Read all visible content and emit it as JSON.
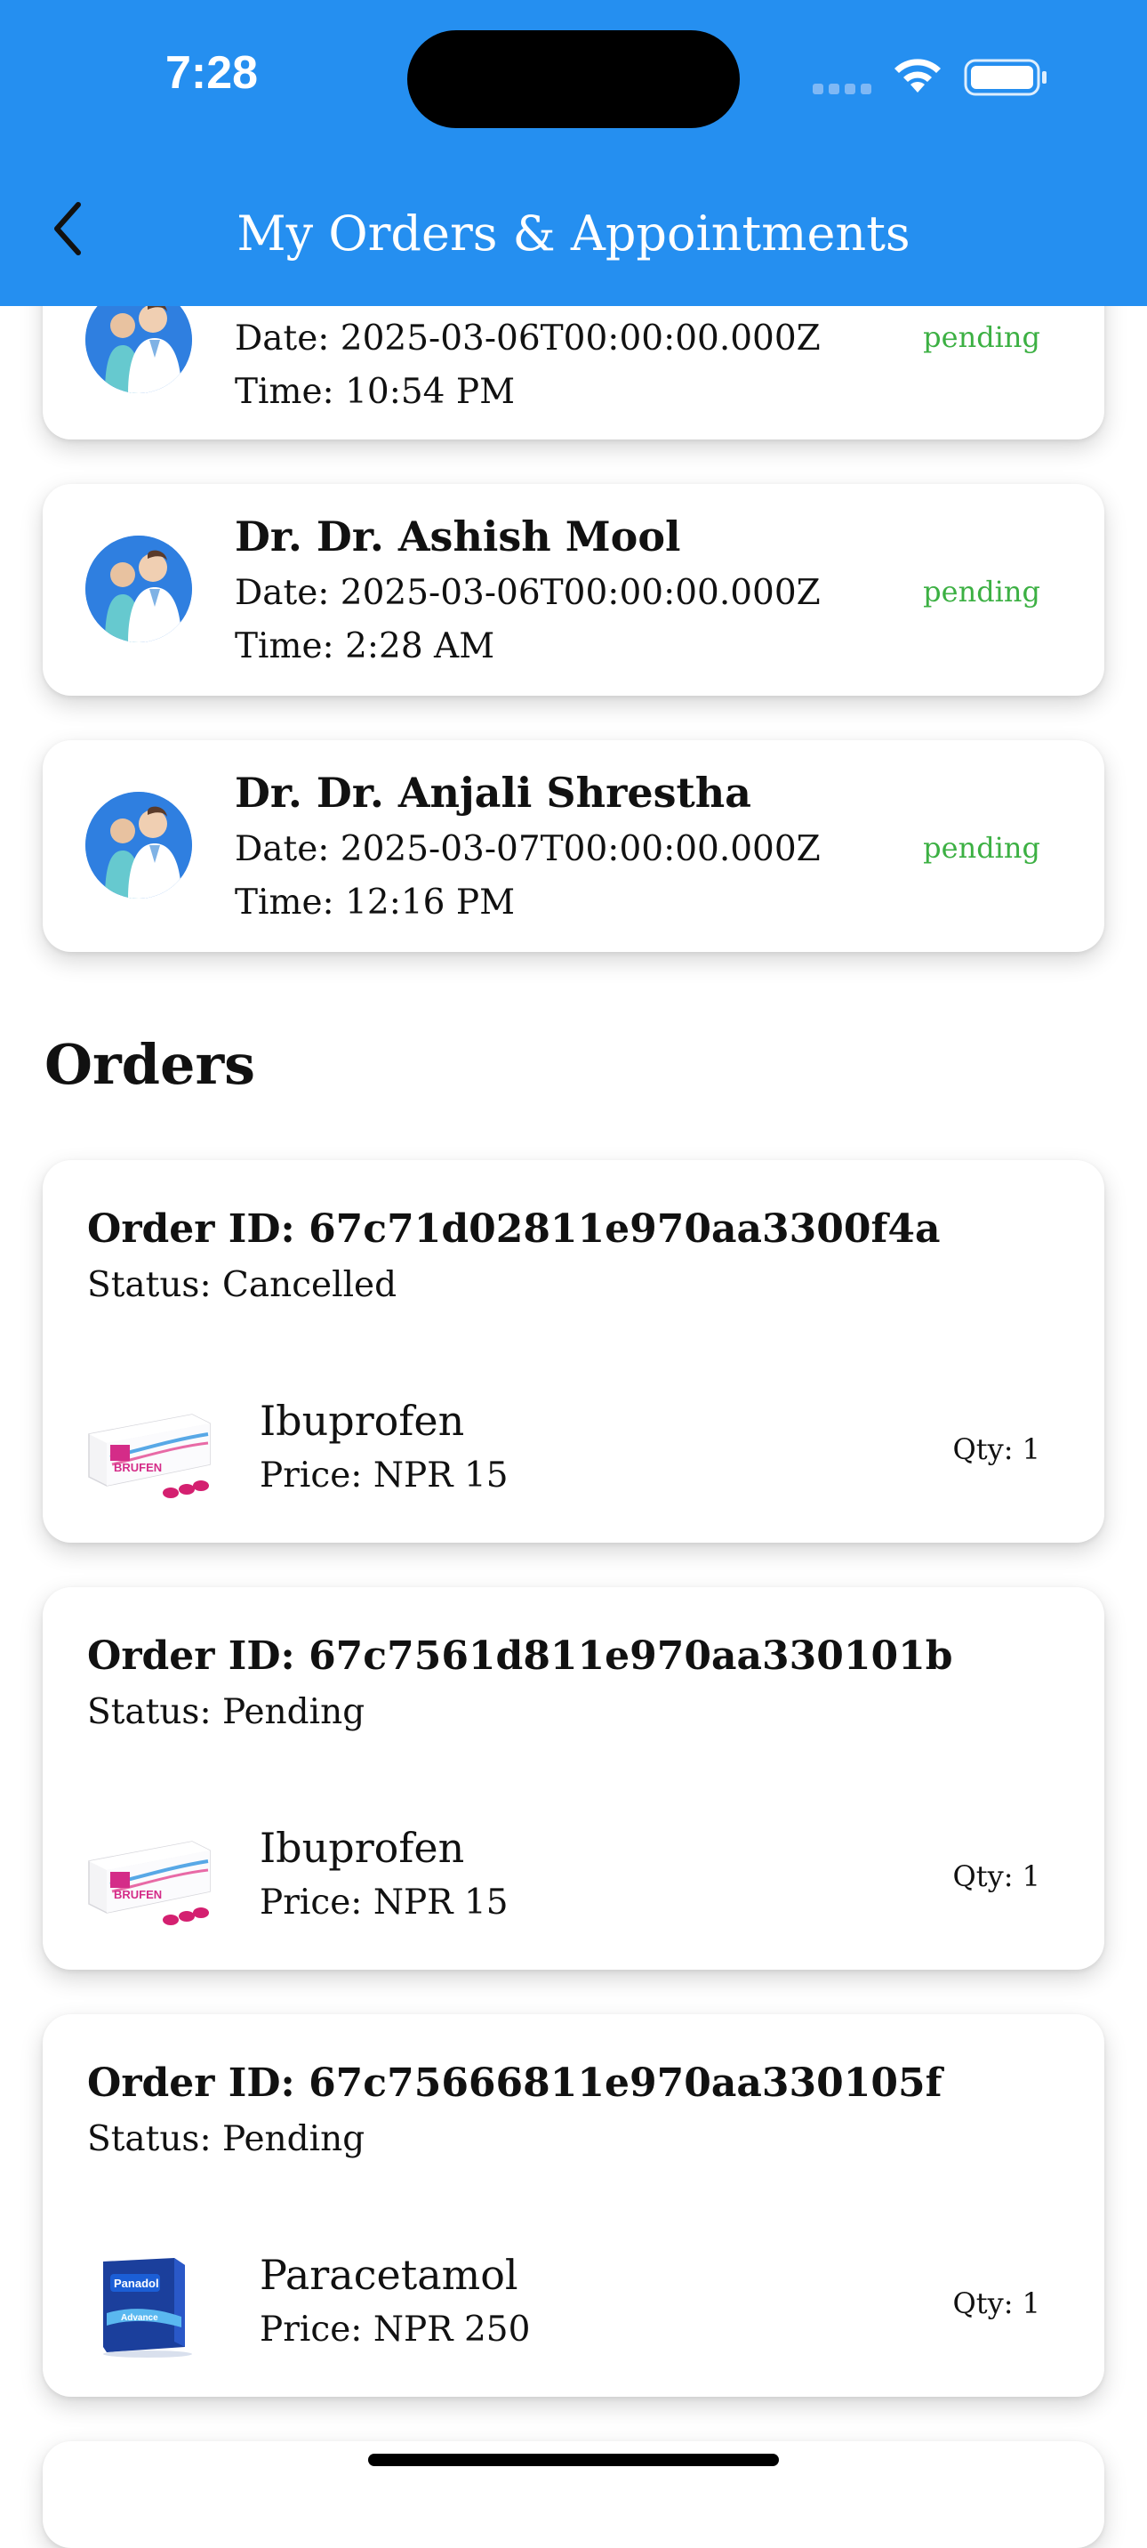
{
  "status_bar": {
    "time": "7:28"
  },
  "header": {
    "title": "My Orders & Appointments"
  },
  "appointments": [
    {
      "doctor": "",
      "date": "Date: 2025-03-06T00:00:00.000Z",
      "time": "Time: 10:54 PM",
      "status": "pending"
    },
    {
      "doctor": "Dr. Dr. Ashish Mool",
      "date": "Date: 2025-03-06T00:00:00.000Z",
      "time": "Time: 2:28 AM",
      "status": "pending"
    },
    {
      "doctor": "Dr. Dr. Anjali Shrestha",
      "date": "Date: 2025-03-07T00:00:00.000Z",
      "time": "Time: 12:16 PM",
      "status": "pending"
    }
  ],
  "orders_section": {
    "title": "Orders"
  },
  "orders": [
    {
      "order_id": "Order ID: 67c71d02811e970aa3300f4a",
      "status": "Status: Cancelled",
      "item": {
        "name": "Ibuprofen",
        "price": "Price: NPR 15",
        "qty": "Qty: 1",
        "image": "brufen-box"
      }
    },
    {
      "order_id": "Order ID: 67c7561d811e970aa330101b",
      "status": "Status: Pending",
      "item": {
        "name": "Ibuprofen",
        "price": "Price: NPR 15",
        "qty": "Qty: 1",
        "image": "brufen-box"
      }
    },
    {
      "order_id": "Order ID: 67c75666811e970aa330105f",
      "status": "Status: Pending",
      "item": {
        "name": "Paracetamol",
        "price": "Price: NPR 250",
        "qty": "Qty: 1",
        "image": "panadol-box"
      }
    }
  ],
  "colors": {
    "header": "#258ff0",
    "pending": "#3cb043",
    "avatar_bg": "#2f7fe0"
  }
}
